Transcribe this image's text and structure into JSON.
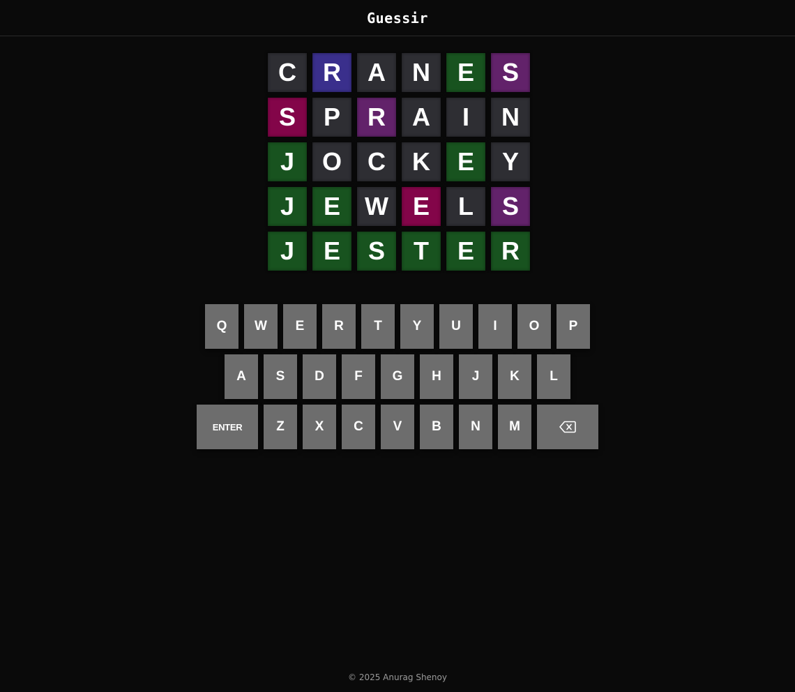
{
  "header": {
    "title": "Guessir"
  },
  "board": {
    "rows": [
      [
        {
          "letter": "C",
          "state": "absent"
        },
        {
          "letter": "R",
          "state": "blue"
        },
        {
          "letter": "A",
          "state": "absent"
        },
        {
          "letter": "N",
          "state": "absent"
        },
        {
          "letter": "E",
          "state": "correct"
        },
        {
          "letter": "S",
          "state": "purple"
        }
      ],
      [
        {
          "letter": "S",
          "state": "magenta"
        },
        {
          "letter": "P",
          "state": "absent"
        },
        {
          "letter": "R",
          "state": "purple"
        },
        {
          "letter": "A",
          "state": "absent"
        },
        {
          "letter": "I",
          "state": "absent"
        },
        {
          "letter": "N",
          "state": "absent"
        }
      ],
      [
        {
          "letter": "J",
          "state": "correct"
        },
        {
          "letter": "O",
          "state": "absent"
        },
        {
          "letter": "C",
          "state": "absent"
        },
        {
          "letter": "K",
          "state": "absent"
        },
        {
          "letter": "E",
          "state": "correct"
        },
        {
          "letter": "Y",
          "state": "absent"
        }
      ],
      [
        {
          "letter": "J",
          "state": "correct"
        },
        {
          "letter": "E",
          "state": "correct"
        },
        {
          "letter": "W",
          "state": "absent"
        },
        {
          "letter": "E",
          "state": "magenta"
        },
        {
          "letter": "L",
          "state": "absent"
        },
        {
          "letter": "S",
          "state": "purple"
        }
      ],
      [
        {
          "letter": "J",
          "state": "correct"
        },
        {
          "letter": "E",
          "state": "correct"
        },
        {
          "letter": "S",
          "state": "correct"
        },
        {
          "letter": "T",
          "state": "correct"
        },
        {
          "letter": "E",
          "state": "correct"
        },
        {
          "letter": "R",
          "state": "correct"
        }
      ]
    ]
  },
  "keyboard": {
    "rows": [
      [
        "Q",
        "W",
        "E",
        "R",
        "T",
        "Y",
        "U",
        "I",
        "O",
        "P"
      ],
      [
        "A",
        "S",
        "D",
        "F",
        "G",
        "H",
        "J",
        "K",
        "L"
      ],
      [
        "ENTER",
        "Z",
        "X",
        "C",
        "V",
        "B",
        "N",
        "M",
        "BACKSPACE"
      ]
    ],
    "enter_label": "ENTER",
    "backspace_icon": "backspace-icon"
  },
  "colors": {
    "background": "#0a0a0a",
    "tile_absent": "#2e2e33",
    "tile_correct": "#18531f",
    "tile_blue": "#3a2f8c",
    "tile_purple": "#62226a",
    "tile_magenta": "#830549",
    "key": "#6d6d6d"
  },
  "footer": {
    "text": "© 2025 Anurag Shenoy"
  }
}
